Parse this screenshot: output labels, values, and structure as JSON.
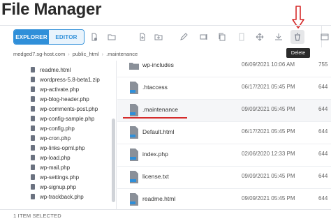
{
  "app": {
    "title": "File Manager"
  },
  "toolbar": {
    "tabs": [
      "EXPLORER",
      "EDITOR"
    ],
    "tooltip": "Delete"
  },
  "breadcrumb": [
    "medged7.sg-host.com",
    "public_html",
    ".maintenance"
  ],
  "sidebar": {
    "items": [
      "readme.html",
      "wordpress-5.8-beta1.zip",
      "wp-activate.php",
      "wp-blog-header.php",
      "wp-comments-post.php",
      "wp-config-sample.php",
      "wp-config.php",
      "wp-cron.php",
      "wp-links-opml.php",
      "wp-load.php",
      "wp-mail.php",
      "wp-settings.php",
      "wp-signup.php",
      "wp-trackback.php"
    ]
  },
  "files": [
    {
      "name": "wp-includes",
      "date": "06/09/2021 10:06 AM",
      "perm": "755",
      "kind": "folder"
    },
    {
      "name": ".htaccess",
      "date": "06/17/2021 05:45 PM",
      "perm": "644",
      "kind": "file"
    },
    {
      "name": ".maintenance",
      "date": "09/09/2021 05:45 PM",
      "perm": "644",
      "kind": "file"
    },
    {
      "name": "Default.html",
      "date": "06/17/2021 05:45 PM",
      "perm": "644",
      "kind": "html"
    },
    {
      "name": "index.php",
      "date": "02/06/2020 12:33 PM",
      "perm": "644",
      "kind": "php"
    },
    {
      "name": "license.txt",
      "date": "09/09/2021 05:45 PM",
      "perm": "644",
      "kind": "txt"
    },
    {
      "name": "readme.html",
      "date": "09/09/2021 05:45 PM",
      "perm": "644",
      "kind": "html"
    }
  ],
  "status": {
    "text": "1 ITEM SELECTED"
  },
  "colors": {
    "accent": "#2f8fd9",
    "highlight": "#d52b2b"
  }
}
